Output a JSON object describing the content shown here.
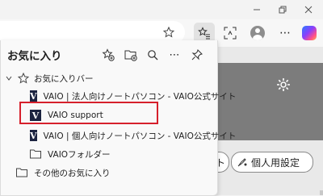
{
  "panel": {
    "title": "お気に入り",
    "items": [
      {
        "label": "お気に入りバー",
        "kind": "folder-star",
        "expanded": true
      },
      {
        "label": "VAIO | 法人向けノートパソコン - VAIO公式サイト",
        "kind": "site"
      },
      {
        "label": "VAIO support",
        "kind": "site",
        "highlighted": true
      },
      {
        "label": "VAIO | 個人向けノートパソコン - VAIO公式サイト",
        "kind": "site"
      },
      {
        "label": "VAIOフォルダー",
        "kind": "folder"
      },
      {
        "label": "その他のお気に入り",
        "kind": "folder"
      }
    ],
    "site_badge": "V"
  },
  "page": {
    "pill_left": "ト",
    "settings_pill": "個人用設定"
  },
  "colors": {
    "highlight": "#d6202c",
    "vaio_badge": "#1b2340"
  }
}
